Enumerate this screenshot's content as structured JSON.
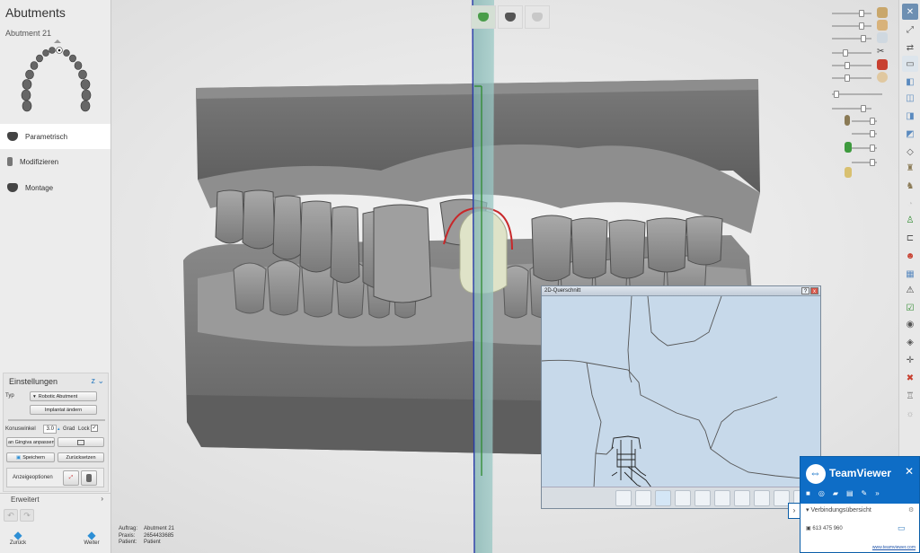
{
  "app": {
    "title": "Abutments",
    "subtitle": "Abutment 21"
  },
  "steps": [
    {
      "label": "Parametrisch",
      "active": true
    },
    {
      "label": "Modifizieren",
      "active": false
    },
    {
      "label": "Montage",
      "active": false
    }
  ],
  "settings": {
    "header": "Einstellungen",
    "typ_label": "Typ",
    "typ_value": "Robotic Abutment",
    "implant_button": "Implantat ändern",
    "konus_label": "Konuswinkel",
    "konus_value": "3.0",
    "konus_unit": "Grad",
    "lock_label": "Lock",
    "lock_checked": "✓",
    "gingiva_button": "an Gingiva anpassen",
    "save_button": "Speichern",
    "reset_button": "Zurücksetzen",
    "display_label": "Anzeigeoptionen"
  },
  "advanced": {
    "label": "Erweitert"
  },
  "nav": {
    "back": "Zurück",
    "next": "Weiter"
  },
  "order": {
    "auftrag_label": "Auftrag:",
    "auftrag_value": "Abutment 21",
    "praxis_label": "Praxis:",
    "praxis_value": "2654433685",
    "patient_label": "Patient:",
    "patient_value": "Patient"
  },
  "cross_section": {
    "title": "2D-Querschnitt",
    "help": "?",
    "close": "x"
  },
  "teamviewer": {
    "name": "TeamViewer",
    "close": "✕",
    "overview": "Verbindungsübersicht",
    "partner_id": "613 475 960",
    "link": "www.teamviewer.com"
  },
  "icons": {
    "tooth": "tooth-icon",
    "back": "arrow-left-icon",
    "next": "arrow-right-icon",
    "undo": "undo-icon",
    "redo": "redo-icon",
    "chevron": "chevron-right-icon"
  },
  "colors": {
    "accent_blue": "#2d8fd5",
    "teamviewer_blue": "#0e6dc6",
    "abutment_red": "#c8282a",
    "active_green": "#4a9d4a"
  }
}
